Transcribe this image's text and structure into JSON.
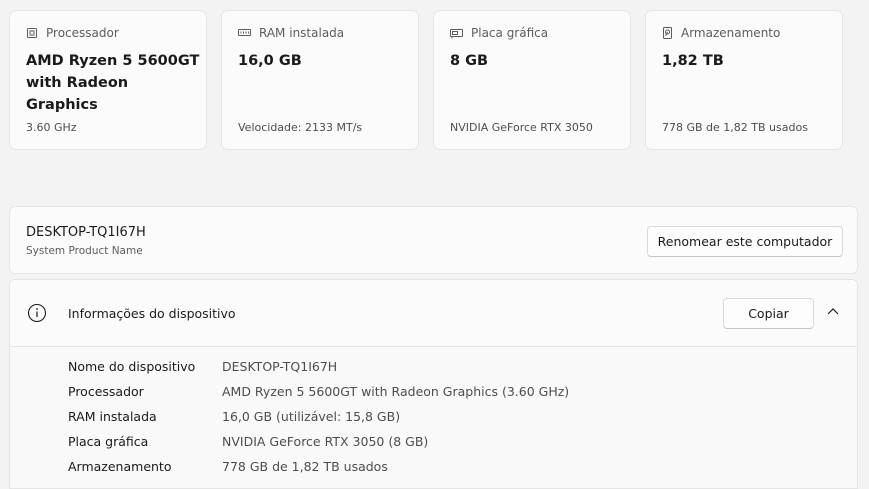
{
  "cards": [
    {
      "category": "Processador",
      "icon": "processor-icon",
      "value": "AMD Ryzen 5 5600GT with Radeon Graphics",
      "sub": "3.60 GHz"
    },
    {
      "category": "RAM instalada",
      "icon": "ram-icon",
      "value": "16,0 GB",
      "sub": "Velocidade: 2133 MT/s"
    },
    {
      "category": "Placa gráfica",
      "icon": "gpu-icon",
      "value": "8 GB",
      "sub": "NVIDIA GeForce RTX 3050"
    },
    {
      "category": "Armazenamento",
      "icon": "storage-icon",
      "value": "1,82 TB",
      "sub": "778 GB de 1,82 TB usados"
    }
  ],
  "pc": {
    "name": "DESKTOP-TQ1I67H",
    "sub": "System Product Name",
    "rename_label": "Renomear este computador"
  },
  "info": {
    "icon": "info-icon",
    "title": "Informações do dispositivo",
    "copy_label": "Copiar",
    "collapse_icon": "chevron-up-icon",
    "rows": [
      {
        "key": "Nome do dispositivo",
        "value": "DESKTOP-TQ1I67H"
      },
      {
        "key": "Processador",
        "value": "AMD Ryzen 5 5600GT with Radeon Graphics (3.60 GHz)"
      },
      {
        "key": "RAM instalada",
        "value": "16,0 GB (utilizável: 15,8 GB)"
      },
      {
        "key": "Placa gráfica",
        "value": "NVIDIA GeForce RTX 3050 (8 GB)"
      },
      {
        "key": "Armazenamento",
        "value": "778 GB de 1,82 TB usados"
      }
    ]
  }
}
